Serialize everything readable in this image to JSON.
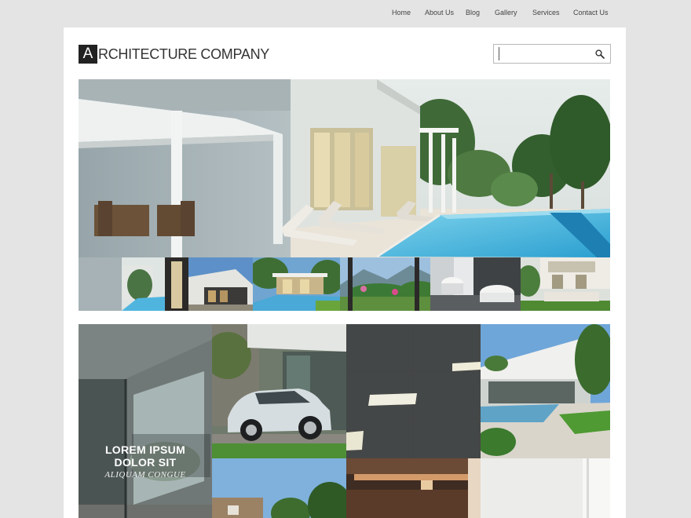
{
  "nav": {
    "items": [
      {
        "label": "Home"
      },
      {
        "label": "About Us"
      },
      {
        "label": "Blog"
      },
      {
        "label": "Gallery"
      },
      {
        "label": "Services"
      },
      {
        "label": "Contact Us"
      }
    ]
  },
  "header": {
    "logo_initial": "A",
    "logo_text": "RCHITECTURE COMPANY"
  },
  "search": {
    "value": "",
    "icon": "search-icon"
  },
  "gallery": {
    "caption": {
      "line1": "LOREM IPSUM",
      "line2": "DOLOR SIT",
      "line3": "ALIQUAM CONGUE"
    }
  }
}
